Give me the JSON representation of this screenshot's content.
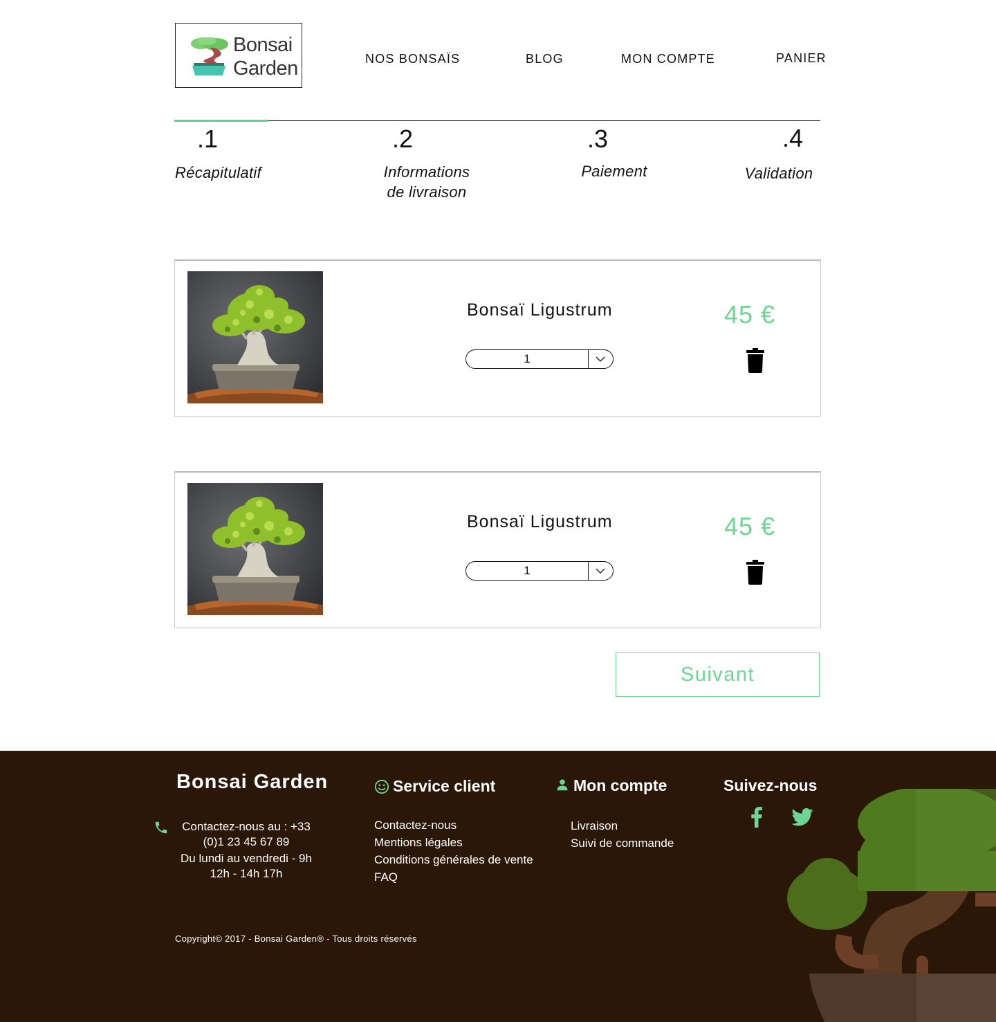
{
  "header": {
    "logo_line1": "Bonsai",
    "logo_line2": "Garden",
    "nav": [
      "NOS BONSAÏS",
      "BLOG",
      "MON COMPTE",
      "PANIER"
    ]
  },
  "steps": [
    {
      "num": ".1",
      "label": "Récapitulatif",
      "active": true
    },
    {
      "num": ".2",
      "label_line1": "Informations",
      "label_line2": "de livraison"
    },
    {
      "num": ".3",
      "label": "Paiement"
    },
    {
      "num": ".4",
      "label": "Validation"
    }
  ],
  "cart": {
    "items": [
      {
        "name": "Bonsaï Ligustrum",
        "quantity": "1",
        "price": "45 €"
      },
      {
        "name": "Bonsaï Ligustrum",
        "quantity": "1",
        "price": "45 €"
      }
    ],
    "next_label": "Suivant"
  },
  "colors": {
    "accent": "#6fd593",
    "footer_bg": "#2b1708"
  },
  "icons": {
    "phone": "phone-icon",
    "service": "smiley-icon",
    "account": "user-icon",
    "facebook": "facebook-icon",
    "twitter": "twitter-icon",
    "trash": "trash-icon"
  },
  "footer": {
    "brand": "Bonsai Garden",
    "contact_line1": "Contactez-nous au : +33",
    "contact_line2": "(0)1 23 45 67 89",
    "hours_line1": "Du lundi au vendredi - 9h",
    "hours_line2": "12h - 14h 17h",
    "service_title": "Service client",
    "service_links": [
      "Contactez-nous",
      "Mentions légales",
      "Conditions générales de vente",
      "FAQ"
    ],
    "account_title": "Mon compte",
    "account_links": [
      "Livraison",
      "Suivi de commande"
    ],
    "follow_title": "Suivez-nous",
    "copyright": "Copyright© 2017 - Bonsai Garden® - Tous droits réservés"
  }
}
